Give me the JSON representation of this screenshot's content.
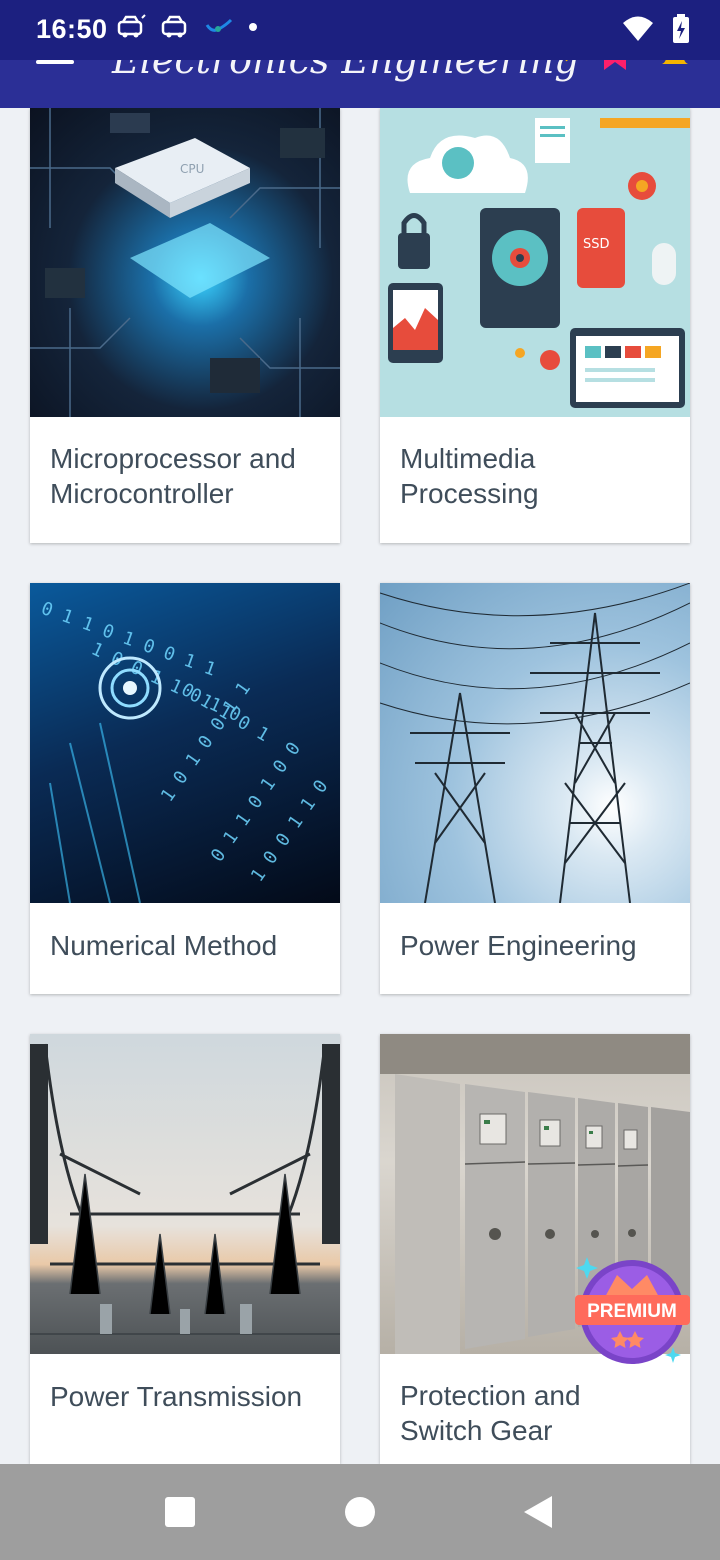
{
  "status_bar": {
    "time": "16:50",
    "icons_left": [
      "car-icon",
      "car-icon",
      "signal-app-icon",
      "dot-icon"
    ],
    "icons_right": [
      "wifi-icon",
      "battery-charging-icon"
    ]
  },
  "app_bar": {
    "title": "Electronics Engineering",
    "icons": [
      "menu-icon",
      "search-icon",
      "bookmark-icon",
      "bell-icon"
    ],
    "color": "#2b2f96"
  },
  "cards": [
    {
      "title": "Microprocessor and Microcontroller",
      "image": "cpu-chip-image"
    },
    {
      "title": "Multimedia Processing",
      "image": "data-storage-illustration"
    },
    {
      "title": "Numerical Method",
      "image": "binary-code-image"
    },
    {
      "title": "Power Engineering",
      "image": "transmission-tower-image"
    },
    {
      "title": "Power Transmission",
      "image": "substation-image"
    },
    {
      "title": "Protection and Switch Gear",
      "image": "switchgear-panel-image"
    }
  ],
  "premium_badge": {
    "label": "PREMIUM"
  },
  "nav_bar": {
    "icons": [
      "recents-square-icon",
      "home-circle-icon",
      "back-triangle-icon"
    ]
  }
}
